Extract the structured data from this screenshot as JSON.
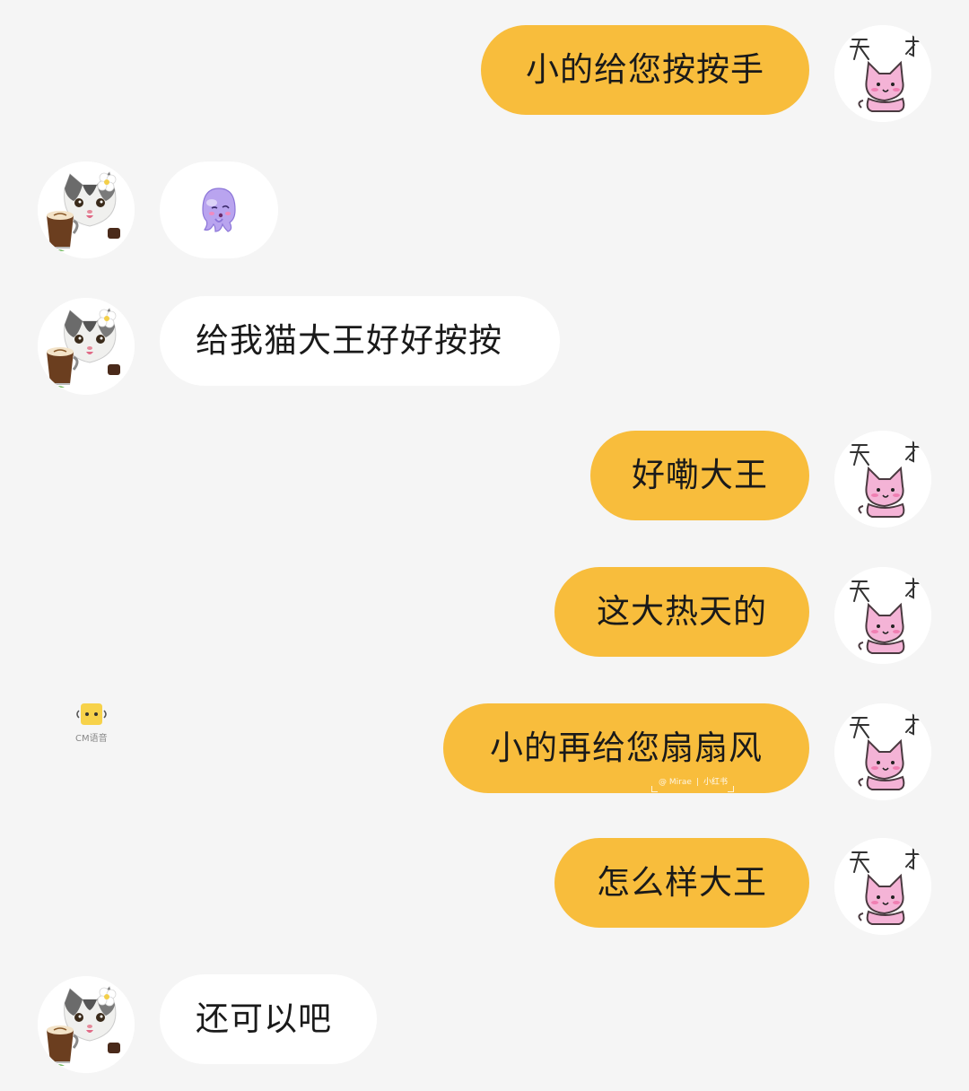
{
  "messages": [
    {
      "id": "m1",
      "side": "out",
      "text": "小的给您按按手"
    },
    {
      "id": "m2",
      "side": "in",
      "sticker": "purple-octopus-sticker"
    },
    {
      "id": "m3",
      "side": "in",
      "text": "给我猫大王好好按按"
    },
    {
      "id": "m4",
      "side": "out",
      "text": "好嘞大王"
    },
    {
      "id": "m5",
      "side": "out",
      "text": "这大热天的"
    },
    {
      "id": "m6",
      "side": "out",
      "text": "小的再给您扇扇风"
    },
    {
      "id": "m7",
      "side": "out",
      "text": "怎么样大王"
    },
    {
      "id": "m8",
      "side": "in",
      "text": "还可以吧"
    }
  ],
  "my_avatar": {
    "icon": "pink-cat-avatar-icon",
    "caption": "天 才"
  },
  "their_avatar": {
    "icon": "cat-with-coffee-avatar-icon"
  },
  "watermark": {
    "icon": "cm-app-logo-icon",
    "text": "CM语音"
  },
  "overlay_mark": {
    "left": "@ Mirae",
    "sep": "|",
    "right": "小红书"
  },
  "colors": {
    "background": "#f5f5f5",
    "outgoing_bubble": "#f8bd3c",
    "incoming_bubble": "#ffffff",
    "text": "#1a1a1a"
  }
}
